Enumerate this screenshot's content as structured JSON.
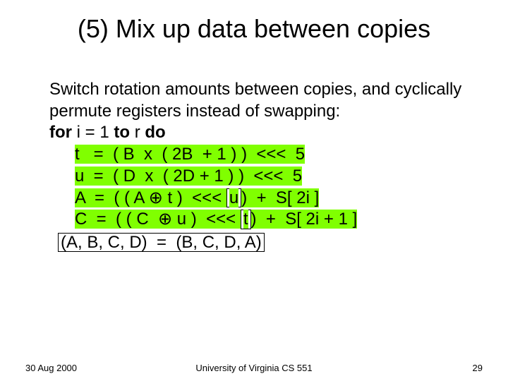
{
  "title": "(5) Mix up data between copies",
  "para": "Switch rotation amounts between copies, and cyclically permute registers instead of swapping:",
  "for": {
    "kw1": "for",
    "mid": "  i  =  1  ",
    "kw2": "to",
    "mid2": "  r  ",
    "kw3": "do"
  },
  "lines": {
    "l1": "t   =  ( B  x  ( 2B  + 1 ) )  <<<  5",
    "l2": "u  =  ( D  x  ( 2D + 1 ) )  <<<  5",
    "l3a": "A  =  ( ( A ",
    "l3b": " t )  <<< ",
    "l3box": "u",
    "l3c": ")  +  S[ 2i ]",
    "l4a": "C  =  ( ( C  ",
    "l4b": " u )  <<< ",
    "l4box": "t",
    "l4c": ")  +  S[ 2i + 1 ]",
    "perm": "(A, B, C, D)  =  (B, C, D, A)"
  },
  "oplus": "⊕",
  "footer": {
    "date": "30 Aug 2000",
    "center": "University of Virginia CS 551",
    "num": "29"
  }
}
